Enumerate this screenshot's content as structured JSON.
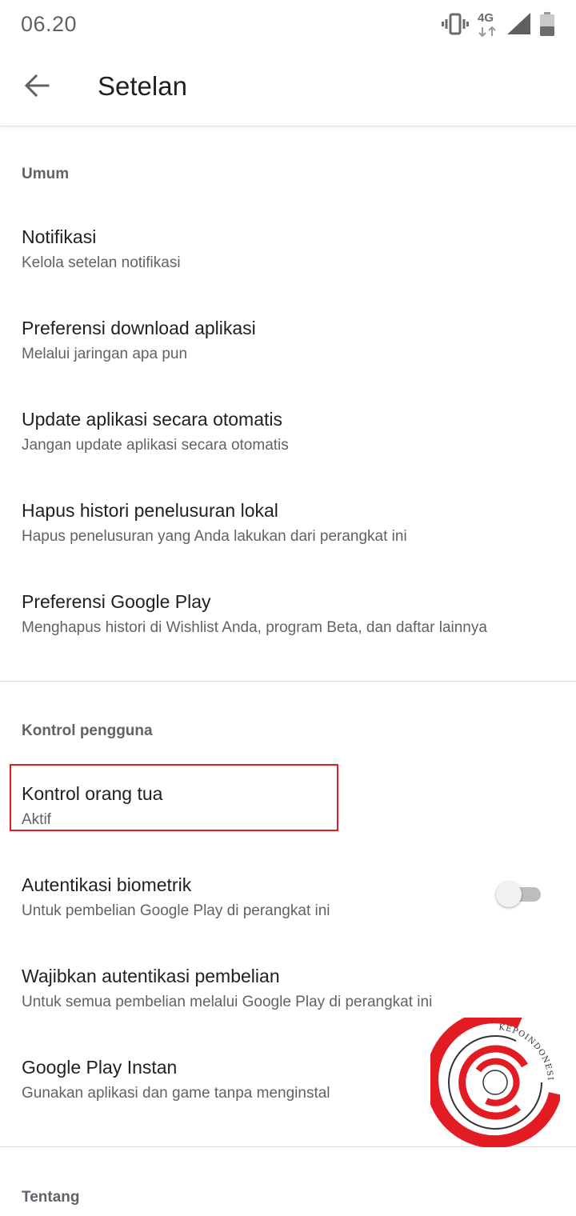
{
  "status_bar": {
    "time": "06.20",
    "network": "4G",
    "icons": [
      "vibrate-icon",
      "network-4g-icon",
      "signal-icon",
      "battery-icon"
    ]
  },
  "app_bar": {
    "back_icon": "arrow-back-icon",
    "title": "Setelan"
  },
  "sections": {
    "general": {
      "header": "Umum",
      "items": [
        {
          "title": "Notifikasi",
          "subtitle": "Kelola setelan notifikasi"
        },
        {
          "title": "Preferensi download aplikasi",
          "subtitle": "Melalui jaringan apa pun"
        },
        {
          "title": "Update aplikasi secara otomatis",
          "subtitle": "Jangan update aplikasi secara otomatis"
        },
        {
          "title": "Hapus histori penelusuran lokal",
          "subtitle": "Hapus penelusuran yang Anda lakukan dari perangkat ini"
        },
        {
          "title": "Preferensi Google Play",
          "subtitle": "Menghapus histori di Wishlist Anda, program Beta, dan daftar lainnya"
        }
      ]
    },
    "user_controls": {
      "header": "Kontrol pengguna",
      "items": [
        {
          "title": "Kontrol orang tua",
          "subtitle": "Aktif"
        },
        {
          "title": "Autentikasi biometrik",
          "subtitle": "Untuk pembelian Google Play di perangkat ini",
          "toggle_on": false
        },
        {
          "title": "Wajibkan autentikasi pembelian",
          "subtitle": "Untuk semua pembelian melalui Google Play di perangkat ini"
        },
        {
          "title": "Google Play Instan",
          "subtitle": "Gunakan aplikasi dan game tanpa menginstal"
        }
      ]
    },
    "about": {
      "header": "Tentang"
    }
  },
  "watermark": {
    "text": "KEPOINDONESIA",
    "color": "#e31b23"
  },
  "colors": {
    "highlight": "#e31b23",
    "primary_text": "#202124",
    "secondary_text": "#5f6368"
  }
}
